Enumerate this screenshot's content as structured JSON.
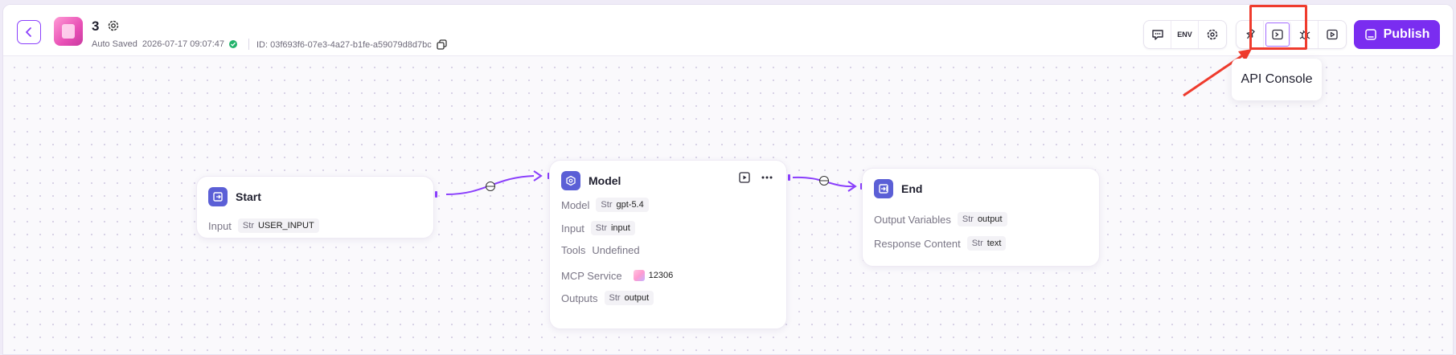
{
  "header": {
    "app_name": "3",
    "auto_saved_label": "Auto Saved",
    "auto_saved_time": "2026-07-17 09:07:47",
    "id_label": "ID: 03f693f6-07e3-4a27-b1fe-a59079d8d7bc",
    "env_label": "ENV",
    "publish_label": "Publish",
    "tooltip": "API Console"
  },
  "nodes": {
    "start": {
      "title": "Start",
      "rows": [
        {
          "label": "Input",
          "type": "Str",
          "value": "USER_INPUT"
        }
      ]
    },
    "model": {
      "title": "Model",
      "model_label": "Model",
      "model_type": "Str",
      "model_value": "gpt-5.4",
      "input_label": "Input",
      "input_type": "Str",
      "input_value": "input",
      "tools_label": "Tools",
      "tools_value": "Undefined",
      "mcp_label": "MCP Service",
      "mcp_value": "12306",
      "outputs_label": "Outputs",
      "outputs_type": "Str",
      "outputs_value": "output"
    },
    "end": {
      "title": "End",
      "ov_label": "Output Variables",
      "ov_type": "Str",
      "ov_value": "output",
      "rc_label": "Response Content",
      "rc_type": "Str",
      "rc_value": "text"
    }
  },
  "colors": {
    "accent": "#7a2df0",
    "annotation": "#ef3b2d",
    "node_icon": "#5b5fd6",
    "edge": "#8a3ffc"
  }
}
